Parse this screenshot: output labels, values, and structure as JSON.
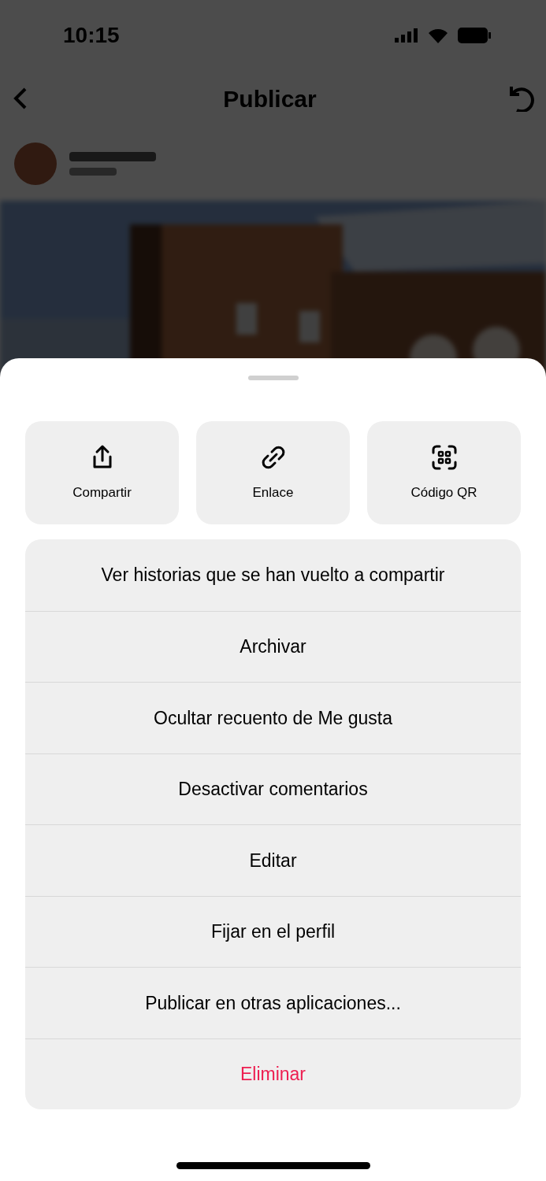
{
  "background": {
    "status_time": "10:15",
    "title": "Publicar"
  },
  "quick_actions": [
    {
      "kind": "share",
      "label": "Compartir"
    },
    {
      "kind": "link",
      "label": "Enlace"
    },
    {
      "kind": "qr",
      "label": "Código QR"
    }
  ],
  "menu": [
    {
      "kind": "normal",
      "label": "Ver historias que se han vuelto a compartir"
    },
    {
      "kind": "normal",
      "label": "Archivar"
    },
    {
      "kind": "normal",
      "label": "Ocultar recuento de Me gusta"
    },
    {
      "kind": "normal",
      "label": "Desactivar comentarios"
    },
    {
      "kind": "normal",
      "label": "Editar"
    },
    {
      "kind": "normal",
      "label": "Fijar en el perfil"
    },
    {
      "kind": "normal",
      "label": "Publicar en otras aplicaciones..."
    },
    {
      "kind": "destructive",
      "label": "Eliminar"
    }
  ]
}
